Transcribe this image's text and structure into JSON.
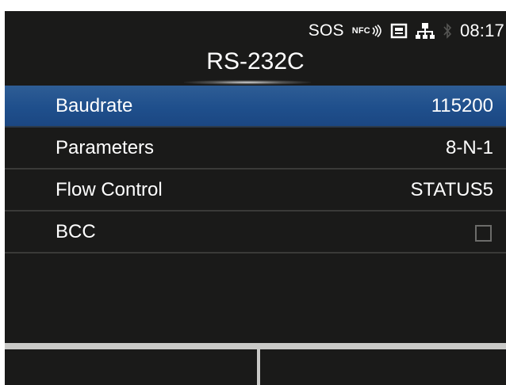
{
  "status_bar": {
    "sos": "SOS",
    "nfc": "NFC",
    "time": "08:17",
    "icons": [
      "nfc-icon",
      "card-icon",
      "network-icon",
      "bluetooth-icon"
    ]
  },
  "title": "RS-232C",
  "colors": {
    "background": "#1a1a19",
    "selected_row": "#1f4f8c",
    "divider": "#3a3a38",
    "softkey_bar": "#c9c9c7",
    "text": "#ffffff"
  },
  "settings": [
    {
      "label": "Baudrate",
      "value": "115200",
      "selected": true
    },
    {
      "label": "Parameters",
      "value": "8-N-1",
      "selected": false
    },
    {
      "label": "Flow Control",
      "value": "STATUS5",
      "selected": false
    },
    {
      "label": "BCC",
      "value": "",
      "type": "checkbox",
      "checked": false,
      "selected": false
    }
  ],
  "softkeys": {
    "left": "",
    "right": ""
  }
}
